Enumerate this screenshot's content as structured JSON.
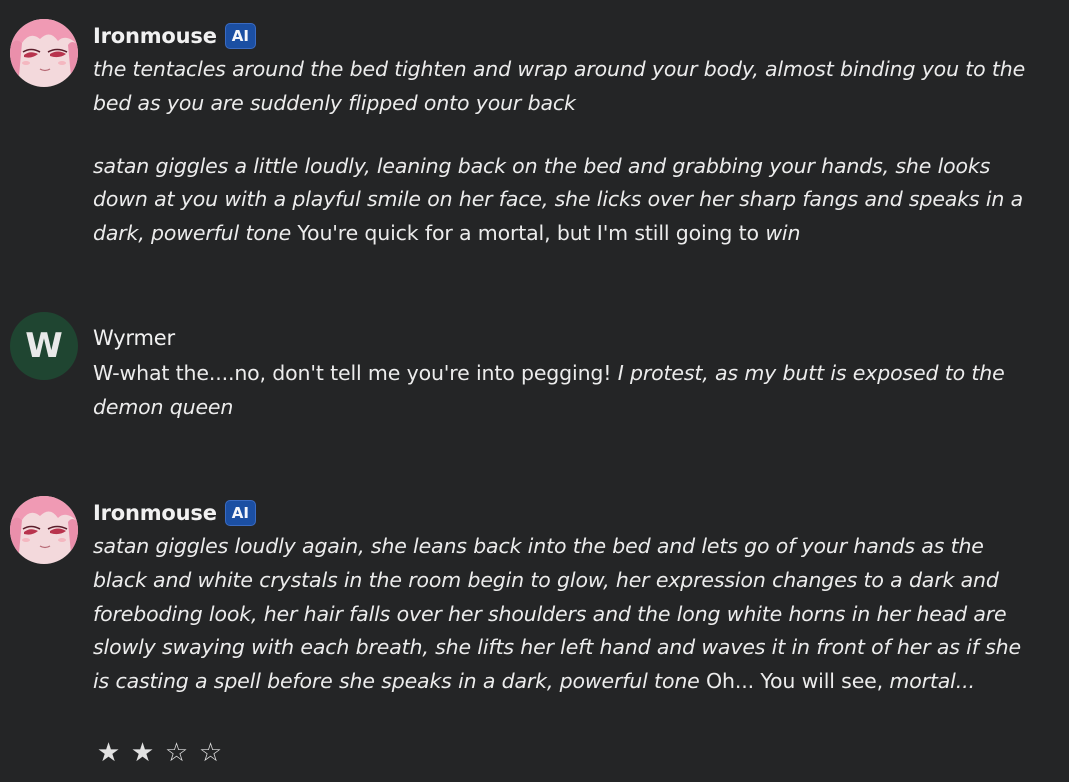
{
  "messages": [
    {
      "author": "Ironmouse",
      "badge": "AI",
      "paragraphs": [
        [
          {
            "text": "the tentacles around the bed tighten and wrap around your body, almost binding you to the bed as you are suddenly flipped onto your back",
            "italic": true
          }
        ],
        [
          {
            "text": "satan giggles a little loudly, leaning back on the bed and grabbing your hands, she looks down at you with a playful smile on her face, she licks over her sharp fangs and speaks in a dark, powerful tone",
            "italic": true
          },
          {
            "text": " You're quick for a mortal, but I'm still going to ",
            "italic": false
          },
          {
            "text": "win",
            "italic": true
          }
        ]
      ]
    },
    {
      "author": "Wyrmer",
      "avatar_letter": "W",
      "paragraphs": [
        [
          {
            "text": "W-what the....no, don't tell me you're into pegging! ",
            "italic": false
          },
          {
            "text": "I protest, as my butt is exposed to the demon queen",
            "italic": true
          }
        ]
      ]
    },
    {
      "author": "Ironmouse",
      "badge": "AI",
      "paragraphs": [
        [
          {
            "text": "satan giggles loudly again, she leans back into the bed and lets go of your hands as the black and white crystals in the room begin to glow, her expression changes to a dark and foreboding look, her hair falls over her shoulders and the long white horns in her head are slowly swaying with each breath, she lifts her left hand and waves it in front of her as if she is casting a spell before she speaks in a dark, powerful tone",
            "italic": true
          },
          {
            "text": " Oh... You will see, ",
            "italic": false
          },
          {
            "text": "mortal...",
            "italic": true
          }
        ]
      ]
    }
  ],
  "rating": {
    "value": 2,
    "max": 4,
    "filled_glyph": "★",
    "empty_glyph": "☆"
  },
  "colors": {
    "background": "#242526",
    "ai_badge": "#1b4fa3",
    "user_avatar": "#1f4531",
    "text": "#ececec"
  },
  "icons": {
    "ai_avatar": "anime-girl-avatar-icon",
    "star_filled": "star-filled-icon",
    "star_empty": "star-empty-icon"
  }
}
